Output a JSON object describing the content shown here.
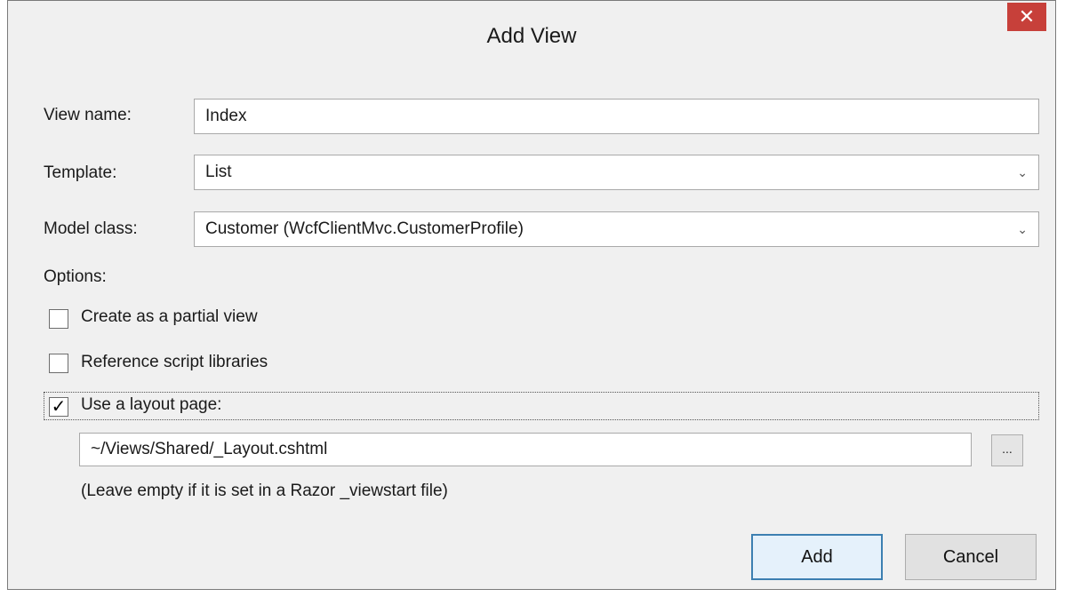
{
  "dialog": {
    "title": "Add View",
    "close_glyph": "✕"
  },
  "form": {
    "view_name_label": "View name:",
    "view_name_value": "Index",
    "template_label": "Template:",
    "template_value": "List",
    "model_class_label": "Model class:",
    "model_class_value": "Customer (WcfClientMvc.CustomerProfile)",
    "dropdown_glyph": "⌄"
  },
  "options": {
    "heading": "Options:",
    "partial_view": {
      "label": "Create as a partial view",
      "checked": false
    },
    "script_libraries": {
      "label": "Reference script libraries",
      "checked": false
    },
    "layout_page": {
      "label": "Use a layout page:",
      "checked": true,
      "check_glyph": "✓"
    },
    "layout_path": "~/Views/Shared/_Layout.cshtml",
    "browse_label": "...",
    "hint": "(Leave empty if it is set in a Razor _viewstart file)"
  },
  "buttons": {
    "add": "Add",
    "cancel": "Cancel"
  }
}
